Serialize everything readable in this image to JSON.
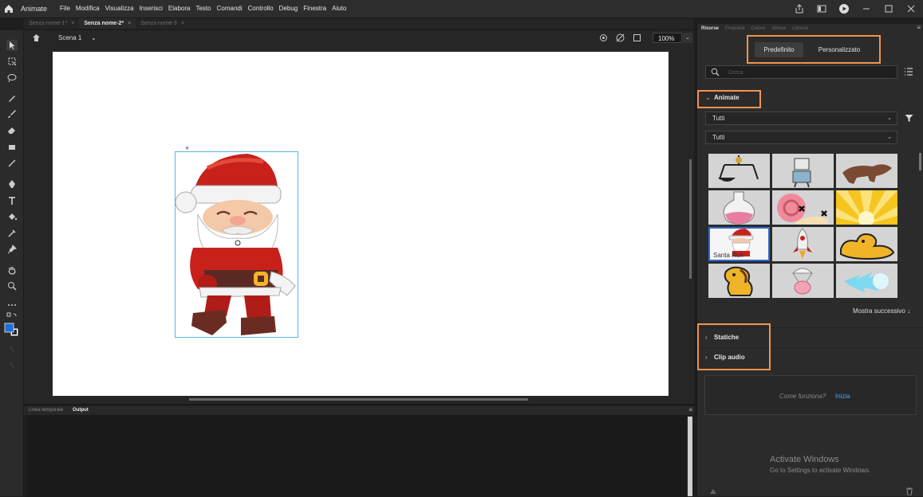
{
  "app": {
    "name": "Animate"
  },
  "menu": [
    "File",
    "Modifica",
    "Visualizza",
    "Inserisci",
    "Elabora",
    "Testo",
    "Comandi",
    "Controllo",
    "Debug",
    "Finestra",
    "Aiuto"
  ],
  "doc_tabs": [
    {
      "label": "Senza nome-1*",
      "active": false
    },
    {
      "label": "Senza nome-2*",
      "active": true
    },
    {
      "label": "Senza nome-3",
      "active": false
    }
  ],
  "scene": {
    "label": "Scena 1",
    "zoom": "100%"
  },
  "bottom_tabs": [
    "Linea temporale",
    "Output"
  ],
  "right_tabs": [
    "Risorse",
    "Proprietà",
    "Colore",
    "Allinea",
    "Libreria"
  ],
  "assets": {
    "segment_default": "Predefinito",
    "segment_custom": "Personalizzato",
    "search_placeholder": "Cerca",
    "section_animate": "Animate",
    "filter1": "Tutti",
    "filter2": "Tutti",
    "selected_caption": "Santa Run",
    "more": "Mostra successivo ↓",
    "section_static": "Statiche",
    "section_audio": "Clip audio",
    "help_question": "Come funziona?",
    "help_link": "Inizia"
  },
  "watermark": {
    "title": "Activate Windows",
    "subtitle": "Go to Settings to activate Windows."
  },
  "colors": {
    "accent_highlight": "#f0944c",
    "fill_color": "#1e6fd9",
    "selection": "#2f6ad0"
  }
}
